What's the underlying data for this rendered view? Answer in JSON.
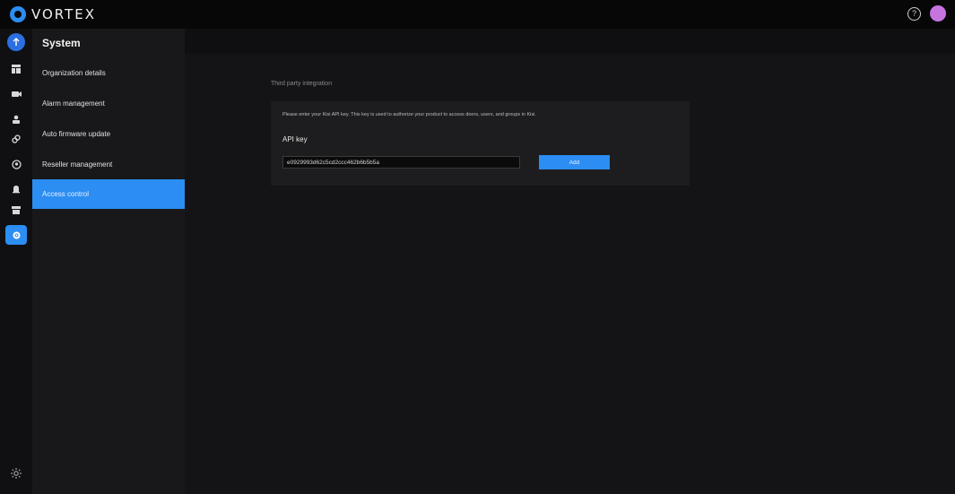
{
  "app": {
    "logo_text": "VORTEX"
  },
  "topbar": {
    "help_icon": "?",
    "avatar_color": "#c874e0"
  },
  "rail": {
    "icons": [
      "upload-icon",
      "dashboard-icon",
      "video-icon",
      "person-icon",
      "link-icon",
      "location-icon",
      "bell-icon",
      "archive-icon",
      "settings-icon",
      "sun-icon"
    ]
  },
  "subnav": {
    "title": "System",
    "items": [
      {
        "label": "Organization details"
      },
      {
        "label": "Alarm management"
      },
      {
        "label": "Auto firmware update"
      },
      {
        "label": "Reseller management"
      },
      {
        "label": "Access control"
      }
    ]
  },
  "main": {
    "section_title": "Third party integration",
    "description": "Please enter your Kisi API key. This key is used to authorize your product to access doors, users, and groups in Kisi.",
    "api_key_label": "API key",
    "api_key_value": "e0929993d62c5cd2ccc462b6b5b5a",
    "add_label": "Add"
  },
  "colors": {
    "accent": "#2c8df2",
    "background": "#0f0f11",
    "panel": "#18181a",
    "card": "#1d1d1f"
  }
}
